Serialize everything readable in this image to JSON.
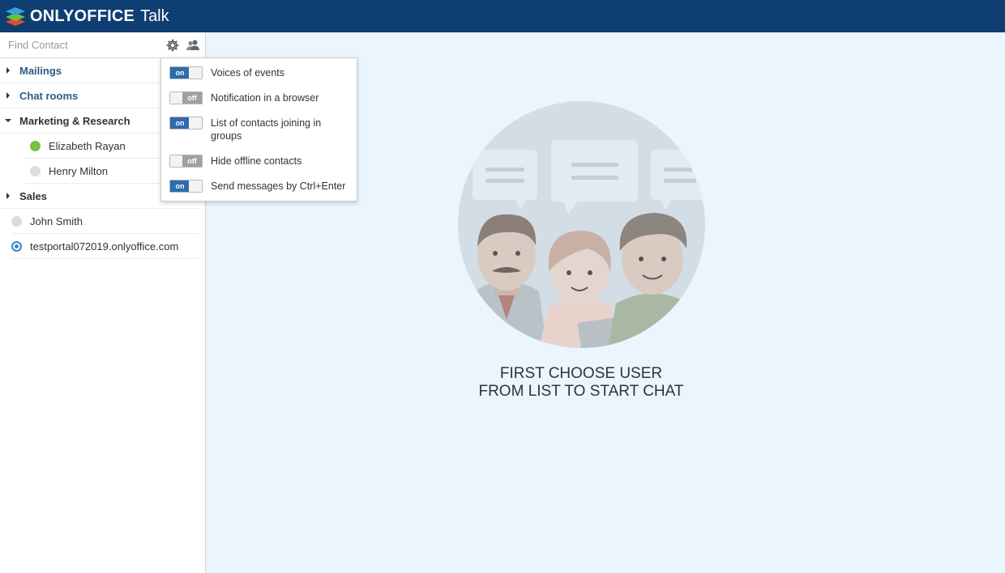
{
  "header": {
    "brand": "ONLYOFFICE",
    "product": "Talk"
  },
  "search": {
    "placeholder": "Find Contact"
  },
  "toolbar": {
    "settings_icon": "gear-icon",
    "users_icon": "users-icon"
  },
  "contacts": {
    "groups": [
      {
        "label": "Mailings",
        "expanded": false
      },
      {
        "label": "Chat rooms",
        "expanded": false
      },
      {
        "label": "Marketing & Research",
        "expanded": true,
        "members": [
          {
            "name": "Elizabeth Rayan",
            "status": "online"
          },
          {
            "name": "Henry Milton",
            "status": "offline"
          }
        ]
      },
      {
        "label": "Sales",
        "expanded": false
      }
    ],
    "ungrouped": [
      {
        "name": "John Smith",
        "status": "offline"
      },
      {
        "name": "testportal072019.onlyoffice.com",
        "status": "self"
      }
    ]
  },
  "settings_menu": {
    "options": [
      {
        "label": "Voices of events",
        "state": "on"
      },
      {
        "label": "Notification in a browser",
        "state": "off"
      },
      {
        "label": "List of contacts joining in groups",
        "state": "on"
      },
      {
        "label": "Hide offline contacts",
        "state": "off"
      },
      {
        "label": "Send messages by Ctrl+Enter",
        "state": "on"
      }
    ]
  },
  "main": {
    "message_line1": "First choose user",
    "message_line2": "from list to start chat"
  },
  "colors": {
    "header_bg": "#0f3e72",
    "main_bg": "#eaf5fd",
    "toggle_on": "#2d6bad",
    "toggle_off": "#a0a0a0",
    "status_online": "#7ac142",
    "status_self": "#3a86c8"
  }
}
